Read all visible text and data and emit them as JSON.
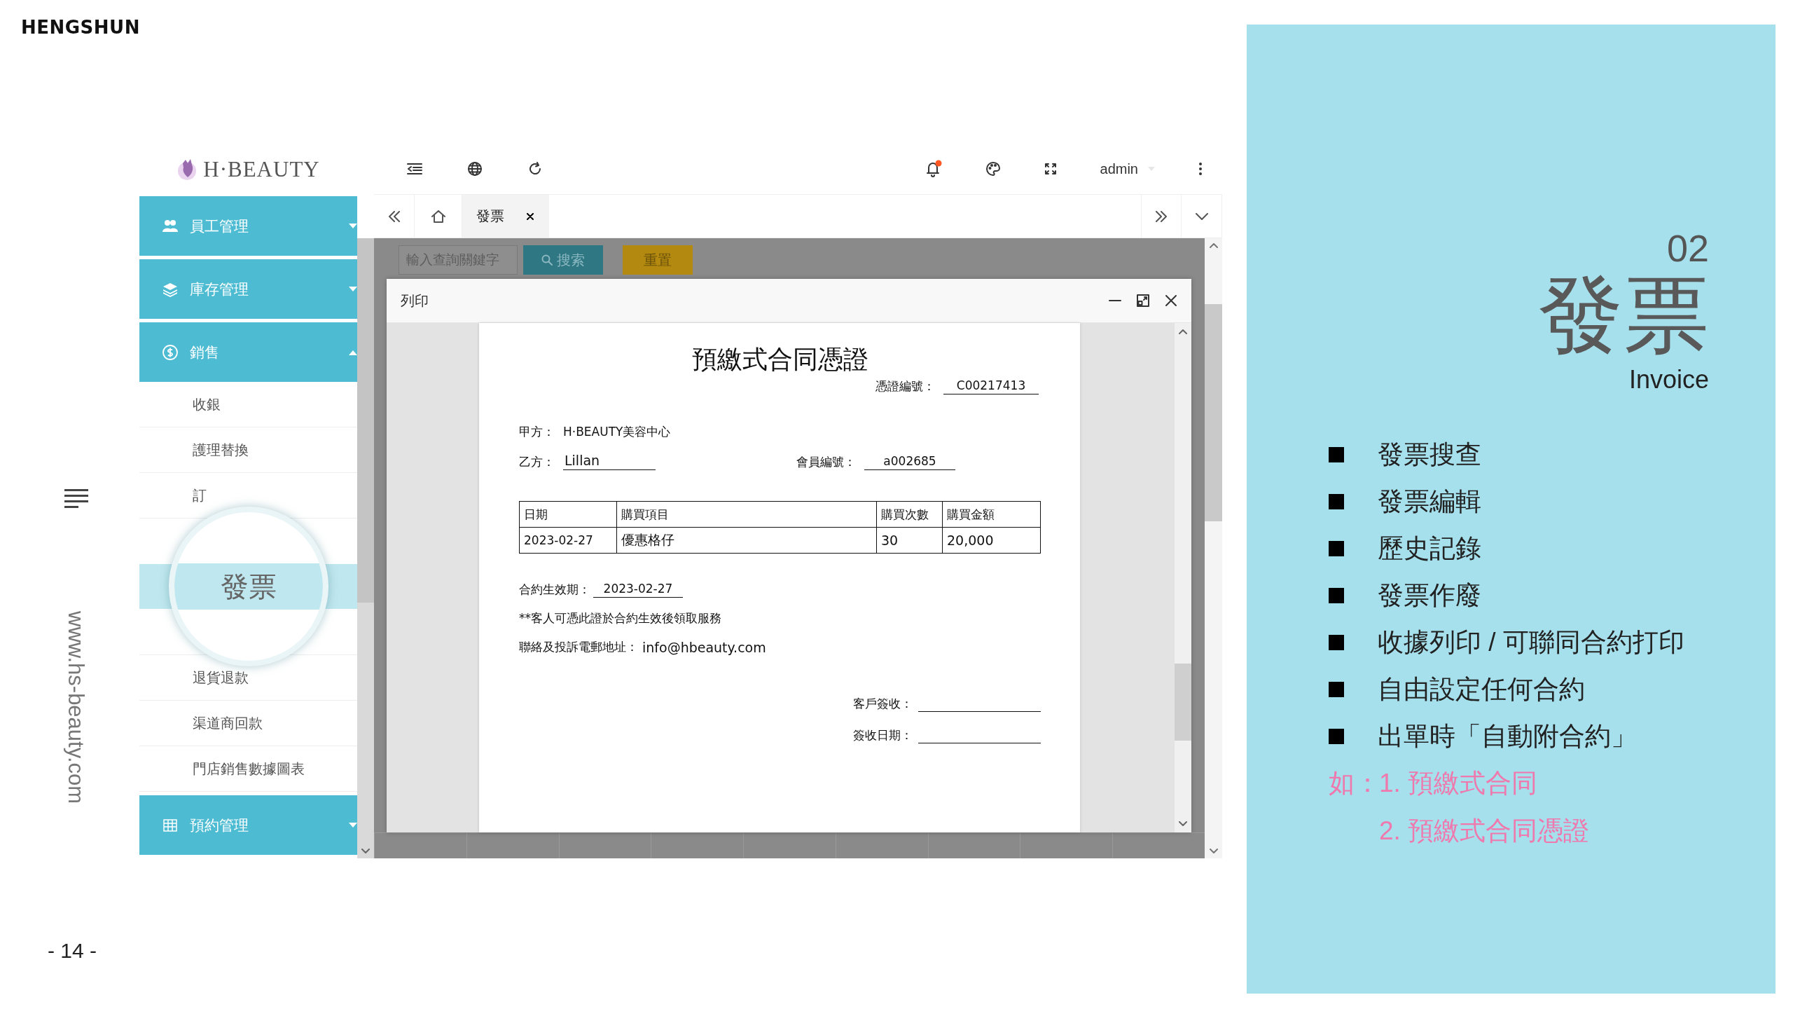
{
  "brand": "HENGSHUN",
  "side_url": "www.hs-beauty.com",
  "page_number": "- 14 -",
  "app": {
    "logo": "H·BEAUTY",
    "topbar": {
      "user": "admin",
      "notification": true
    },
    "tabs": [
      {
        "label": "發票",
        "selected": true
      }
    ],
    "sidebar": {
      "groups": [
        {
          "label": "員工管理",
          "expanded": false
        },
        {
          "label": "庫存管理",
          "expanded": false
        },
        {
          "label": "銷售",
          "expanded": true,
          "children": [
            {
              "label": "收銀",
              "selected": false
            },
            {
              "label": "護理替換",
              "selected": false
            },
            {
              "label": "訂",
              "selected": false
            },
            {
              "selected": true
            },
            {
              "label": "退貨退款",
              "selected": false
            },
            {
              "label": "渠道商回款",
              "selected": false
            },
            {
              "label": "門店銷售數據圖表",
              "selected": false
            }
          ]
        },
        {
          "label": "預約管理",
          "expanded": false
        }
      ],
      "magnifier": {
        "label": "發票"
      }
    },
    "search": {
      "placeholder": "輸入查詢關鍵字",
      "buttons": [
        {
          "label": "搜索",
          "kind": "primary"
        },
        {
          "label": "重置",
          "kind": "warning"
        }
      ]
    },
    "dialog": {
      "title": "列印",
      "document": {
        "title": "預繳式合同憑證",
        "voucher_label": "憑證編號：",
        "voucher_no": "C00217413",
        "party_a_label": "甲方：",
        "party_a": "H‧BEAUTY美容中心",
        "party_b_label": "乙方：",
        "party_b": "Lillan",
        "member_label": "會員編號：",
        "member_no": "a002685",
        "table": {
          "columns": [
            "日期",
            "購買項目",
            "購買次數",
            "購買金額"
          ],
          "rows": [
            [
              "2023-02-27",
              "優惠格仔",
              "30",
              "20,000"
            ]
          ]
        },
        "effective_label": "合約生效期：",
        "effective_date": "2023-02-27",
        "note": "**客人可憑此證於合約生效後領取服務",
        "contact_label": "聯絡及投訴電郵地址：",
        "contact_email": "info@hbeauty.com",
        "signature_label": "客戶簽收：",
        "sign_date_label": "簽收日期："
      }
    }
  },
  "panel": {
    "number": "02",
    "title": "發票",
    "subtitle": "Invoice",
    "features": [
      "發票搜查",
      "發票編輯",
      "歷史記錄",
      "發票作廢",
      "收據列印 / 可聯同合約打印",
      "自由設定任何合約",
      "出單時「自動附合約」"
    ],
    "examples": {
      "label": "如：",
      "items": [
        "1. 預繳式合同",
        "2. 預繳式合同憑證"
      ]
    }
  }
}
